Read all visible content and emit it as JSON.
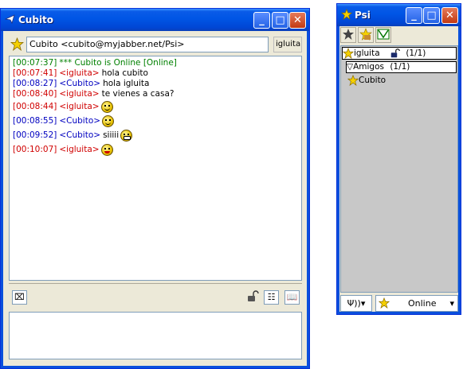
{
  "chat_window": {
    "title": "Cubito",
    "contact_jid": "Cubito <cubito@myjabber.net/Psi>",
    "own_nick": "igluita",
    "messages": [
      {
        "time": "[00:07:37]",
        "text": "*** Cubito is Online [Online]",
        "kind": "status",
        "emoticon": ""
      },
      {
        "time": "[00:07:41]",
        "nick": "<igluita>",
        "text": "hola cubito",
        "kind": "self",
        "emoticon": ""
      },
      {
        "time": "[00:08:27]",
        "nick": "<Cubito>",
        "text": "hola igluita",
        "kind": "other",
        "emoticon": ""
      },
      {
        "time": "[00:08:40]",
        "nick": "<igluita>",
        "text": "te vienes a casa?",
        "kind": "self",
        "emoticon": ""
      },
      {
        "time": "[00:08:44]",
        "nick": "<igluita>",
        "text": "",
        "kind": "self",
        "emoticon": "smile-emoticon"
      },
      {
        "time": "[00:08:55]",
        "nick": "<Cubito>",
        "text": "",
        "kind": "other",
        "emoticon": "smile-emoticon"
      },
      {
        "time": "[00:09:52]",
        "nick": "<Cubito>",
        "text": "siiiii",
        "kind": "other",
        "emoticon": "grin-emoticon"
      },
      {
        "time": "[00:10:07]",
        "nick": "<igluita>",
        "text": "",
        "kind": "self",
        "emoticon": "tongue-emoticon"
      }
    ],
    "input_value": "",
    "icons": {
      "title": "psi-app-icon",
      "status": "star-online-icon",
      "clear": "clear-chat-icon",
      "encrypt": "lock-icon",
      "info": "vcard-icon",
      "history": "history-book-icon"
    }
  },
  "roster_window": {
    "title": "Psi",
    "toolbar_icons": [
      "show-offline-icon",
      "show-away-icon",
      "event-mail-icon"
    ],
    "account": {
      "name": "igluita",
      "count": "(1/1)",
      "lock_icon": "lock-icon"
    },
    "group": {
      "name": "Amigos",
      "count": "(1/1)"
    },
    "contacts": [
      {
        "name": "Cubito",
        "status_icon": "star-online-icon"
      }
    ],
    "status_value": "Online",
    "menu_icon": "psi-menu-icon"
  },
  "colors": {
    "titlebar": "#0055e5",
    "status_line": "#008000",
    "self_nick": "#d00000",
    "other_nick": "#0000c0",
    "online_star": "#f5d000"
  }
}
